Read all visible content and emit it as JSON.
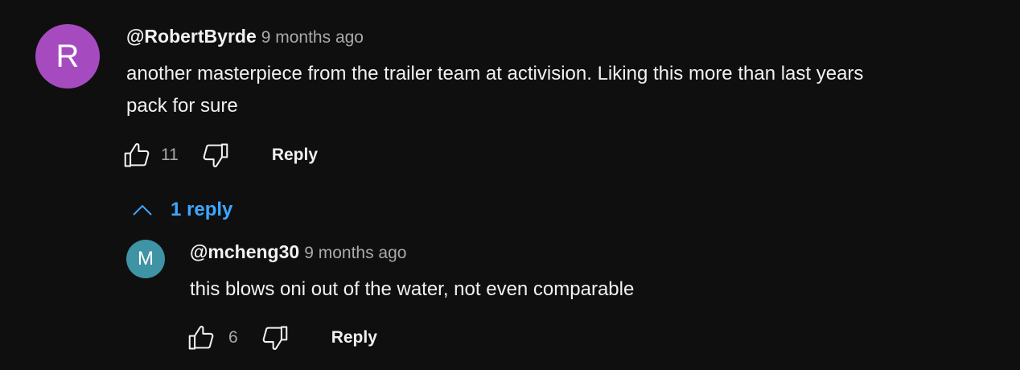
{
  "comment": {
    "avatar_letter": "R",
    "avatar_color": "#a64bbf",
    "author": "@RobertByrde",
    "time": "9 months ago",
    "text_line1": "another masterpiece from the trailer team at activision. Liking this more than last years",
    "text_line2": "pack for sure",
    "likes": "11",
    "reply_label": "Reply"
  },
  "replies_toggle": {
    "label": "1 reply",
    "icon": "chevron-up-icon",
    "color": "#3ea6ff"
  },
  "reply": {
    "avatar_letter": "M",
    "avatar_color": "#3e93a4",
    "author": "@mcheng30",
    "time": "9 months ago",
    "text": "this blows oni out of the water, not even comparable",
    "likes": "6",
    "reply_label": "Reply"
  },
  "icons": {
    "like": "thumb-up-icon",
    "dislike": "thumb-down-icon"
  }
}
